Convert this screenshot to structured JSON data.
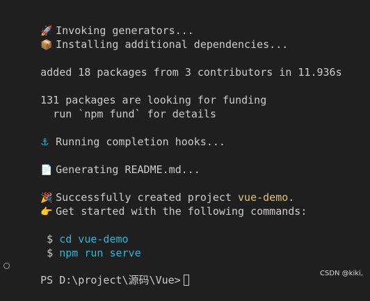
{
  "terminal": {
    "lines": {
      "invoking": {
        "icon": "🚀",
        "text": "Invoking generators..."
      },
      "installing": {
        "icon": "📦",
        "text": "Installing additional dependencies..."
      },
      "added": {
        "text": "added 18 packages from 3 contributors in 11.936s"
      },
      "funding1": {
        "text": "131 packages are looking for funding"
      },
      "funding2": {
        "text": "  run `npm fund` for details"
      },
      "hooks": {
        "icon": "⚓",
        "text": "Running completion hooks..."
      },
      "readme": {
        "icon": "📄",
        "text": "Generating README.md..."
      },
      "success": {
        "icon": "🎉",
        "prefix": "Successfully created project ",
        "project": "vue-demo",
        "suffix": "."
      },
      "getstarted": {
        "icon": "👉",
        "text": "Get started with the following commands:"
      },
      "cmd1": {
        "dollar": " $ ",
        "command": "cd vue-demo"
      },
      "cmd2": {
        "dollar": " $ ",
        "command": "npm run serve"
      }
    },
    "prompt": "PS D:\\project\\源码\\Vue>"
  },
  "watermark": "CSDN @kiki,",
  "colors": {
    "background": "#1f1f1f",
    "text": "#cccccc",
    "highlight": "#e5c07b",
    "command": "#29b8db"
  }
}
